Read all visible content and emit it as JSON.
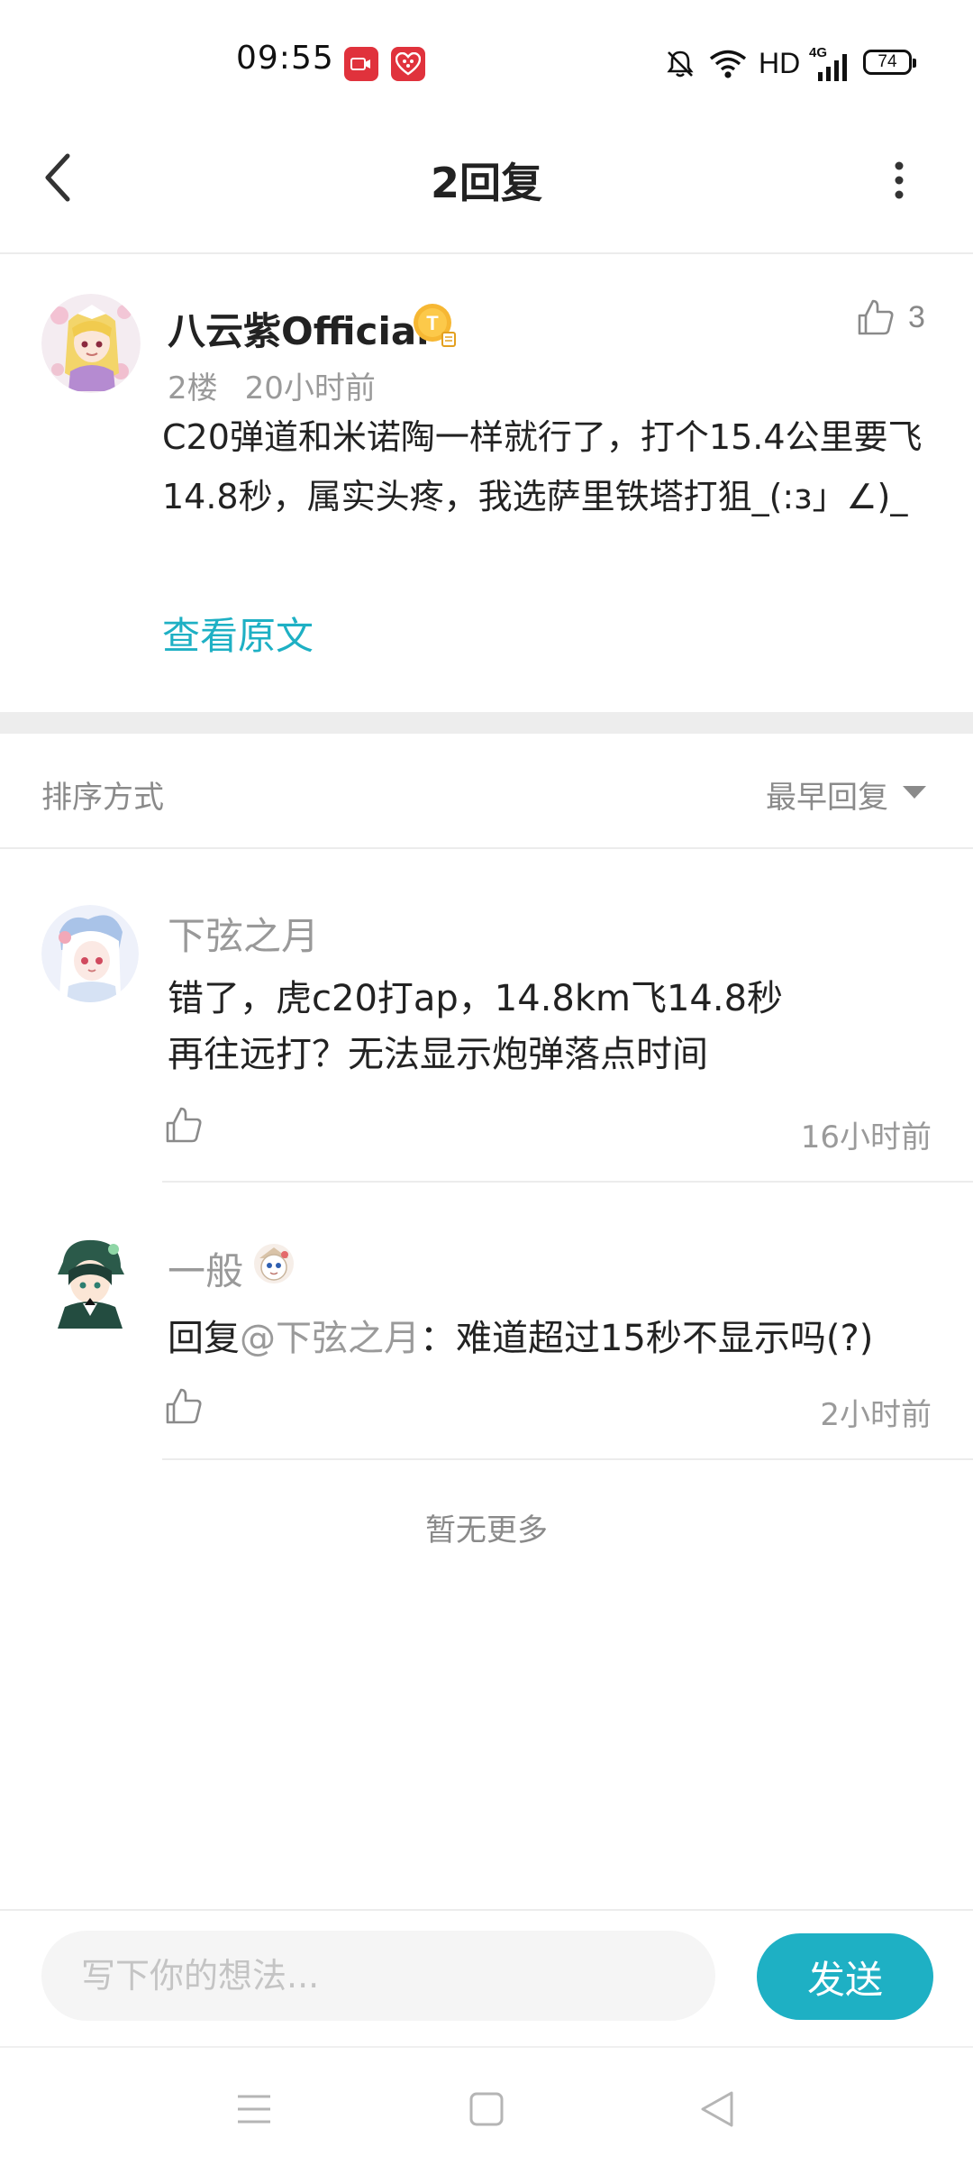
{
  "status_bar": {
    "time": "09:55",
    "network": "HD",
    "signal_label": "4G",
    "battery": "74",
    "icons": [
      "video-record-icon",
      "app-notification-icon",
      "mute-icon",
      "wifi-icon",
      "signal-icon",
      "battery-icon"
    ]
  },
  "header": {
    "title": "2回复",
    "back_icon": "chevron-left-icon",
    "more_icon": "more-vertical-icon"
  },
  "post": {
    "author": "八云紫Official",
    "badge_letter": "T",
    "floor": "2楼",
    "time": "20小时前",
    "like_count": "3",
    "body": "C20弹道和米诺陶一样就行了，打个15.4公里要飞14.8秒，属实头疼，我选萨里铁塔打狙_(:з」∠)_",
    "view_original": "查看原文"
  },
  "sort": {
    "label": "排序方式",
    "value": "最早回复"
  },
  "replies": [
    {
      "author": "下弦之月",
      "line1": "错了，虎c20打ap，14.8km飞14.8秒",
      "line2": "再往远打？无法显示炮弹落点时间",
      "time": "16小时前"
    },
    {
      "author": "一般",
      "reply_prefix": "回复",
      "mention": "@下弦之月",
      "text": "：难道超过15秒不显示吗(?)",
      "time": "2小时前"
    }
  ],
  "footer_note": "暂无更多",
  "composer": {
    "placeholder": "写下你的想法...",
    "send_label": "发送"
  },
  "colors": {
    "accent": "#1eb0c4",
    "muted_text": "#9a9a9a",
    "separator": "#ececec"
  }
}
